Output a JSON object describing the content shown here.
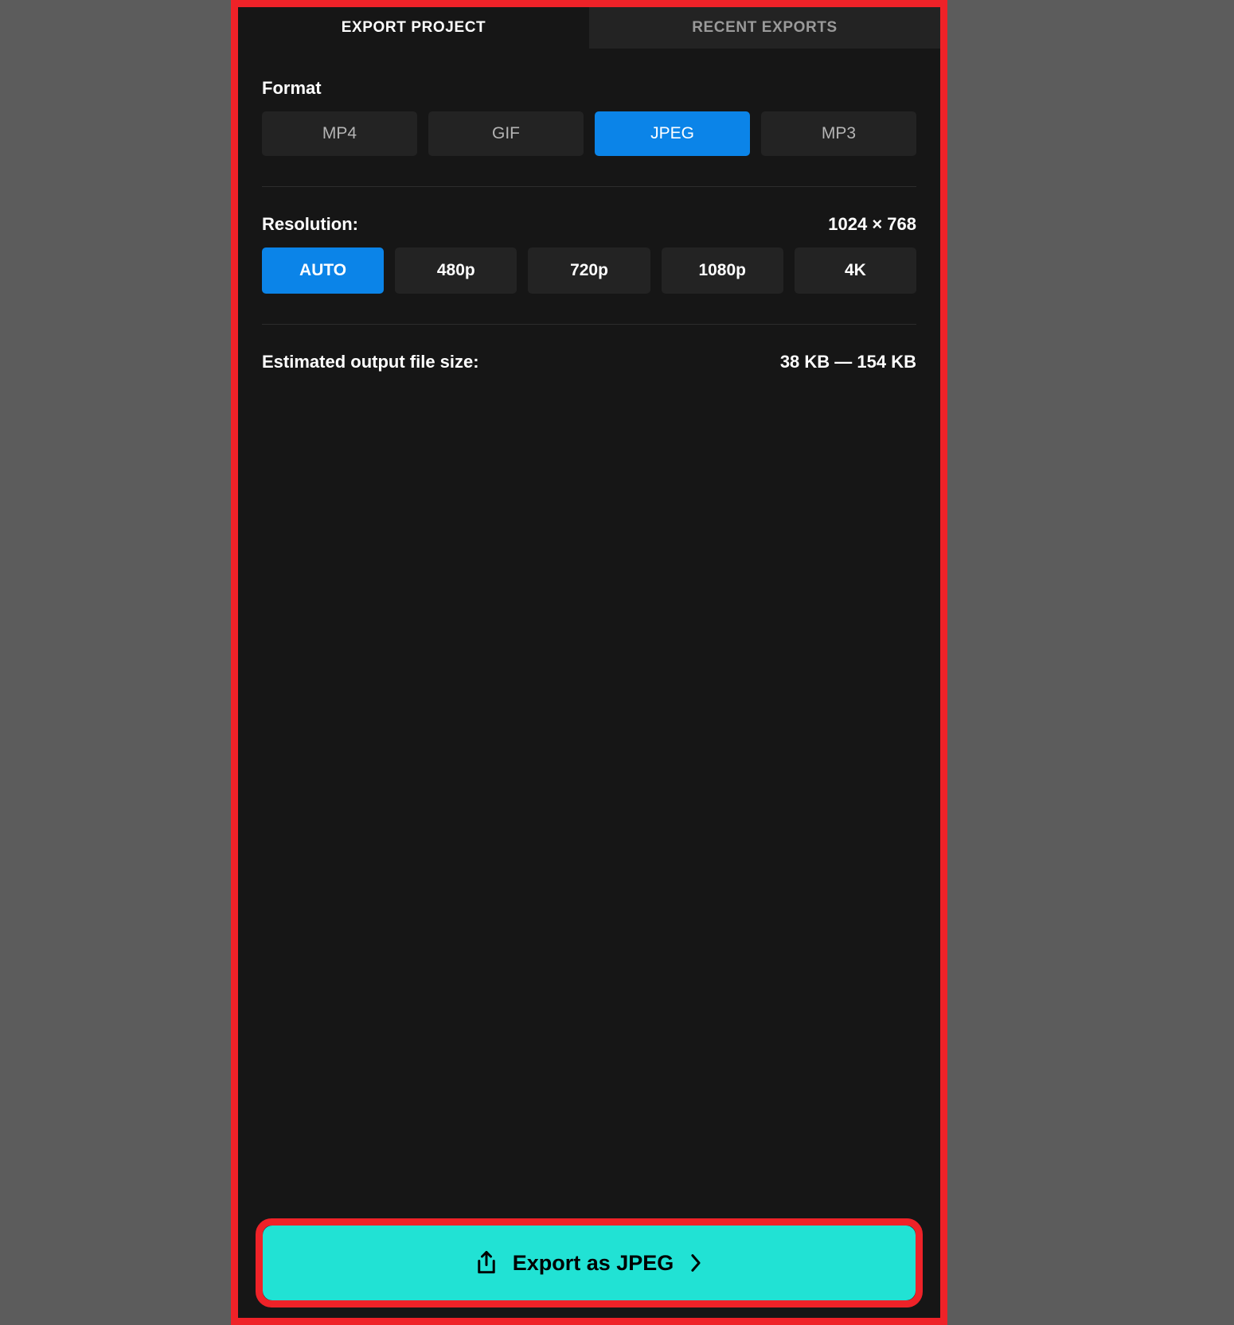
{
  "tabs": [
    {
      "label": "EXPORT PROJECT",
      "active": true,
      "name": "tab-export-project"
    },
    {
      "label": "RECENT EXPORTS",
      "active": false,
      "name": "tab-recent-exports"
    }
  ],
  "format": {
    "label": "Format",
    "options": [
      {
        "label": "MP4",
        "selected": false
      },
      {
        "label": "GIF",
        "selected": false
      },
      {
        "label": "JPEG",
        "selected": true
      },
      {
        "label": "MP3",
        "selected": false
      }
    ],
    "selected": "JPEG"
  },
  "resolution": {
    "label": "Resolution:",
    "value": "1024 × 768",
    "options": [
      {
        "label": "AUTO",
        "selected": true
      },
      {
        "label": "480p",
        "selected": false
      },
      {
        "label": "720p",
        "selected": false
      },
      {
        "label": "1080p",
        "selected": false
      },
      {
        "label": "4K",
        "selected": false
      }
    ],
    "selected": "AUTO"
  },
  "filesize": {
    "label": "Estimated output file size:",
    "value": "38 KB — 154 KB"
  },
  "footer": {
    "export_label": "Export as JPEG",
    "share_icon": "share-upload-icon",
    "chevron_icon": "chevron-right-icon"
  },
  "colors": {
    "accent_blue": "#0b84e8",
    "accent_teal": "#21e2d4",
    "highlight_red": "#ef2228",
    "panel_bg": "#161616",
    "chip_bg": "#232323",
    "page_bg": "#5c5c5c"
  }
}
